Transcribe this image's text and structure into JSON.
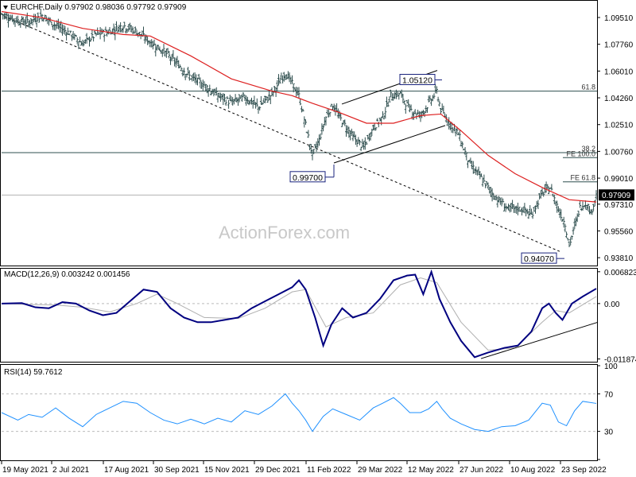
{
  "header": {
    "main": "EURCHF,Daily  0.97902 0.98036 0.97792 0.97909",
    "macd": "MACD(12,26,9) 0.003242 0.001456",
    "rsi": "RSI(14) 59.7612"
  },
  "watermark": "ActionForex.com",
  "colors": {
    "bars": "#2f4f4f",
    "sma": "#dd2020",
    "macd": "#000080",
    "signal": "#b0b0b0",
    "rsi": "#1e90ff",
    "grid": "#dddddd",
    "fib": "#2f4f4f"
  },
  "chart_data": [
    {
      "type": "ohlc",
      "symbol": "EURCHF",
      "timeframe": "Daily",
      "x_tick_labels": [
        "19 May 2021",
        "2 Jul 2021",
        "17 Aug 2021",
        "30 Sep 2021",
        "15 Nov 2021",
        "29 Dec 2021",
        "11 Feb 2022",
        "29 Mar 2022",
        "12 May 2022",
        "27 Jun 2022",
        "10 Aug 2022",
        "23 Sep 2022"
      ],
      "y_tick_labels": [
        "1.09510",
        "1.07760",
        "1.06010",
        "1.04260",
        "1.02510",
        "1.00760",
        "0.99010",
        "0.97310",
        "0.95560",
        "0.93810"
      ],
      "ylim": [
        0.9335,
        1.1055
      ],
      "last_price": "0.97909",
      "close_path": [
        [
          0,
          1.0975
        ],
        [
          10,
          1.0935
        ],
        [
          20,
          1.092
        ],
        [
          30,
          1.0965
        ],
        [
          40,
          1.09
        ],
        [
          50,
          1.085
        ],
        [
          60,
          1.078
        ],
        [
          70,
          1.084
        ],
        [
          80,
          1.086
        ],
        [
          90,
          1.09
        ],
        [
          100,
          1.086
        ],
        [
          110,
          1.079
        ],
        [
          120,
          1.073
        ],
        [
          130,
          1.065
        ],
        [
          140,
          1.056
        ],
        [
          150,
          1.051
        ],
        [
          160,
          1.044
        ],
        [
          170,
          1.0395
        ],
        [
          180,
          1.043
        ],
        [
          190,
          1.0365
        ],
        [
          200,
          1.045
        ],
        [
          210,
          1.059
        ],
        [
          215,
          1.052
        ],
        [
          220,
          1.044
        ],
        [
          225,
          1.025
        ],
        [
          230,
          1.005
        ],
        [
          235,
          1.015
        ],
        [
          240,
          1.03
        ],
        [
          245,
          1.038
        ],
        [
          250,
          1.03
        ],
        [
          260,
          1.017
        ],
        [
          268,
          1.01
        ],
        [
          275,
          1.023
        ],
        [
          282,
          1.03
        ],
        [
          288,
          1.044
        ],
        [
          295,
          1.045
        ],
        [
          302,
          1.035
        ],
        [
          310,
          1.031
        ],
        [
          317,
          1.04
        ],
        [
          322,
          1.047
        ],
        [
          325,
          1.035
        ],
        [
          330,
          1.028
        ],
        [
          338,
          1.019
        ],
        [
          346,
          1.0
        ],
        [
          355,
          0.99
        ],
        [
          365,
          0.978
        ],
        [
          375,
          0.97
        ],
        [
          385,
          0.97
        ],
        [
          392,
          0.966
        ],
        [
          400,
          0.98
        ],
        [
          406,
          0.984
        ],
        [
          412,
          0.97
        ],
        [
          417,
          0.96
        ],
        [
          420,
          0.946
        ],
        [
          423,
          0.955
        ],
        [
          428,
          0.971
        ],
        [
          433,
          0.974
        ],
        [
          436,
          0.967
        ],
        [
          440,
          0.9791
        ]
      ],
      "sma": [
        [
          0,
          1.099
        ],
        [
          30,
          1.095
        ],
        [
          60,
          1.088
        ],
        [
          90,
          1.084
        ],
        [
          110,
          1.083
        ],
        [
          140,
          1.07
        ],
        [
          170,
          1.055
        ],
        [
          200,
          1.047
        ],
        [
          215,
          1.044
        ],
        [
          230,
          1.039
        ],
        [
          250,
          1.033
        ],
        [
          270,
          1.026
        ],
        [
          290,
          1.026
        ],
        [
          310,
          1.031
        ],
        [
          325,
          1.032
        ],
        [
          340,
          1.021
        ],
        [
          360,
          1.005
        ],
        [
          380,
          0.993
        ],
        [
          400,
          0.984
        ],
        [
          420,
          0.976
        ],
        [
          440,
          0.9745
        ]
      ],
      "annotations": [
        {
          "label": "0.99700",
          "value": 0.997
        },
        {
          "label": "1.05120",
          "value": 1.0512
        },
        {
          "label": "0.94070",
          "value": 0.9407
        }
      ],
      "fib_levels": [
        {
          "label": "61.8",
          "value": 1.047
        },
        {
          "label": "38.2",
          "value": 1.0068
        },
        {
          "label": "FE 100.0",
          "value": 1.0035
        },
        {
          "label": "FE 61.8",
          "value": 0.9877
        }
      ],
      "horizontal_level": 0.9791
    },
    {
      "type": "line",
      "name": "MACD(12,26,9)",
      "values_text": [
        "0.003242",
        "0.001456"
      ],
      "y_tick_labels": [
        "0.006823",
        "0.00",
        "-0.011874"
      ],
      "ylim": [
        -0.0123,
        0.0073
      ],
      "macd": [
        [
          0,
          0.0
        ],
        [
          15,
          0.0001
        ],
        [
          25,
          -0.0008
        ],
        [
          35,
          -0.001
        ],
        [
          45,
          0.0003
        ],
        [
          55,
          0.0
        ],
        [
          65,
          -0.0015
        ],
        [
          75,
          -0.0025
        ],
        [
          85,
          -0.002
        ],
        [
          95,
          0.0005
        ],
        [
          105,
          0.003
        ],
        [
          115,
          0.0025
        ],
        [
          125,
          -0.001
        ],
        [
          135,
          -0.003
        ],
        [
          145,
          -0.004
        ],
        [
          155,
          -0.004
        ],
        [
          165,
          -0.0035
        ],
        [
          175,
          -0.003
        ],
        [
          185,
          -0.001
        ],
        [
          195,
          0.0005
        ],
        [
          205,
          0.002
        ],
        [
          215,
          0.0035
        ],
        [
          220,
          0.005
        ],
        [
          225,
          0.003
        ],
        [
          232,
          -0.003
        ],
        [
          238,
          -0.009
        ],
        [
          244,
          -0.0045
        ],
        [
          252,
          -0.001
        ],
        [
          260,
          -0.003
        ],
        [
          270,
          -0.002
        ],
        [
          280,
          0.001
        ],
        [
          290,
          0.005
        ],
        [
          300,
          0.006
        ],
        [
          306,
          0.0062
        ],
        [
          312,
          0.002
        ],
        [
          318,
          0.0068
        ],
        [
          324,
          0.001
        ],
        [
          332,
          -0.004
        ],
        [
          340,
          -0.008
        ],
        [
          350,
          -0.0115
        ],
        [
          360,
          -0.0105
        ],
        [
          372,
          -0.0095
        ],
        [
          382,
          -0.009
        ],
        [
          392,
          -0.006
        ],
        [
          400,
          -0.001
        ],
        [
          405,
          0.0
        ],
        [
          410,
          -0.002
        ],
        [
          415,
          -0.0035
        ],
        [
          422,
          0.0
        ],
        [
          430,
          0.0015
        ],
        [
          440,
          0.0032
        ]
      ],
      "signal": [
        [
          0,
          0.0
        ],
        [
          20,
          -0.0002
        ],
        [
          40,
          -0.0003
        ],
        [
          60,
          -0.0008
        ],
        [
          80,
          -0.0018
        ],
        [
          100,
          0.0
        ],
        [
          115,
          0.002
        ],
        [
          130,
          0.0
        ],
        [
          150,
          -0.003
        ],
        [
          175,
          -0.0032
        ],
        [
          195,
          -0.001
        ],
        [
          215,
          0.0025
        ],
        [
          225,
          0.003
        ],
        [
          240,
          -0.005
        ],
        [
          255,
          -0.003
        ],
        [
          275,
          -0.002
        ],
        [
          295,
          0.004
        ],
        [
          310,
          0.0055
        ],
        [
          322,
          0.0045
        ],
        [
          340,
          -0.004
        ],
        [
          360,
          -0.01
        ],
        [
          380,
          -0.0095
        ],
        [
          400,
          -0.004
        ],
        [
          410,
          -0.0015
        ],
        [
          420,
          -0.002
        ],
        [
          440,
          0.0015
        ]
      ]
    },
    {
      "type": "line",
      "name": "RSI(14)",
      "value_text": "59.7612",
      "y_tick_labels": [
        "100",
        "70",
        "30",
        "0"
      ],
      "ylim": [
        0,
        100
      ],
      "values": [
        [
          0,
          50
        ],
        [
          12,
          42
        ],
        [
          20,
          48
        ],
        [
          30,
          45
        ],
        [
          40,
          55
        ],
        [
          50,
          44
        ],
        [
          60,
          35
        ],
        [
          70,
          48
        ],
        [
          80,
          55
        ],
        [
          90,
          62
        ],
        [
          100,
          60
        ],
        [
          110,
          50
        ],
        [
          120,
          42
        ],
        [
          130,
          38
        ],
        [
          140,
          43
        ],
        [
          150,
          38
        ],
        [
          160,
          44
        ],
        [
          170,
          40
        ],
        [
          180,
          52
        ],
        [
          190,
          48
        ],
        [
          200,
          57
        ],
        [
          210,
          70
        ],
        [
          215,
          60
        ],
        [
          220,
          52
        ],
        [
          225,
          42
        ],
        [
          230,
          30
        ],
        [
          238,
          46
        ],
        [
          245,
          54
        ],
        [
          255,
          48
        ],
        [
          265,
          42
        ],
        [
          275,
          55
        ],
        [
          282,
          60
        ],
        [
          290,
          66
        ],
        [
          295,
          60
        ],
        [
          302,
          50
        ],
        [
          310,
          50
        ],
        [
          316,
          54
        ],
        [
          322,
          62
        ],
        [
          326,
          54
        ],
        [
          332,
          44
        ],
        [
          340,
          38
        ],
        [
          350,
          32
        ],
        [
          360,
          30
        ],
        [
          370,
          35
        ],
        [
          380,
          36
        ],
        [
          390,
          42
        ],
        [
          400,
          60
        ],
        [
          406,
          58
        ],
        [
          412,
          40
        ],
        [
          418,
          36
        ],
        [
          424,
          52
        ],
        [
          430,
          62
        ],
        [
          440,
          59.8
        ]
      ]
    }
  ]
}
